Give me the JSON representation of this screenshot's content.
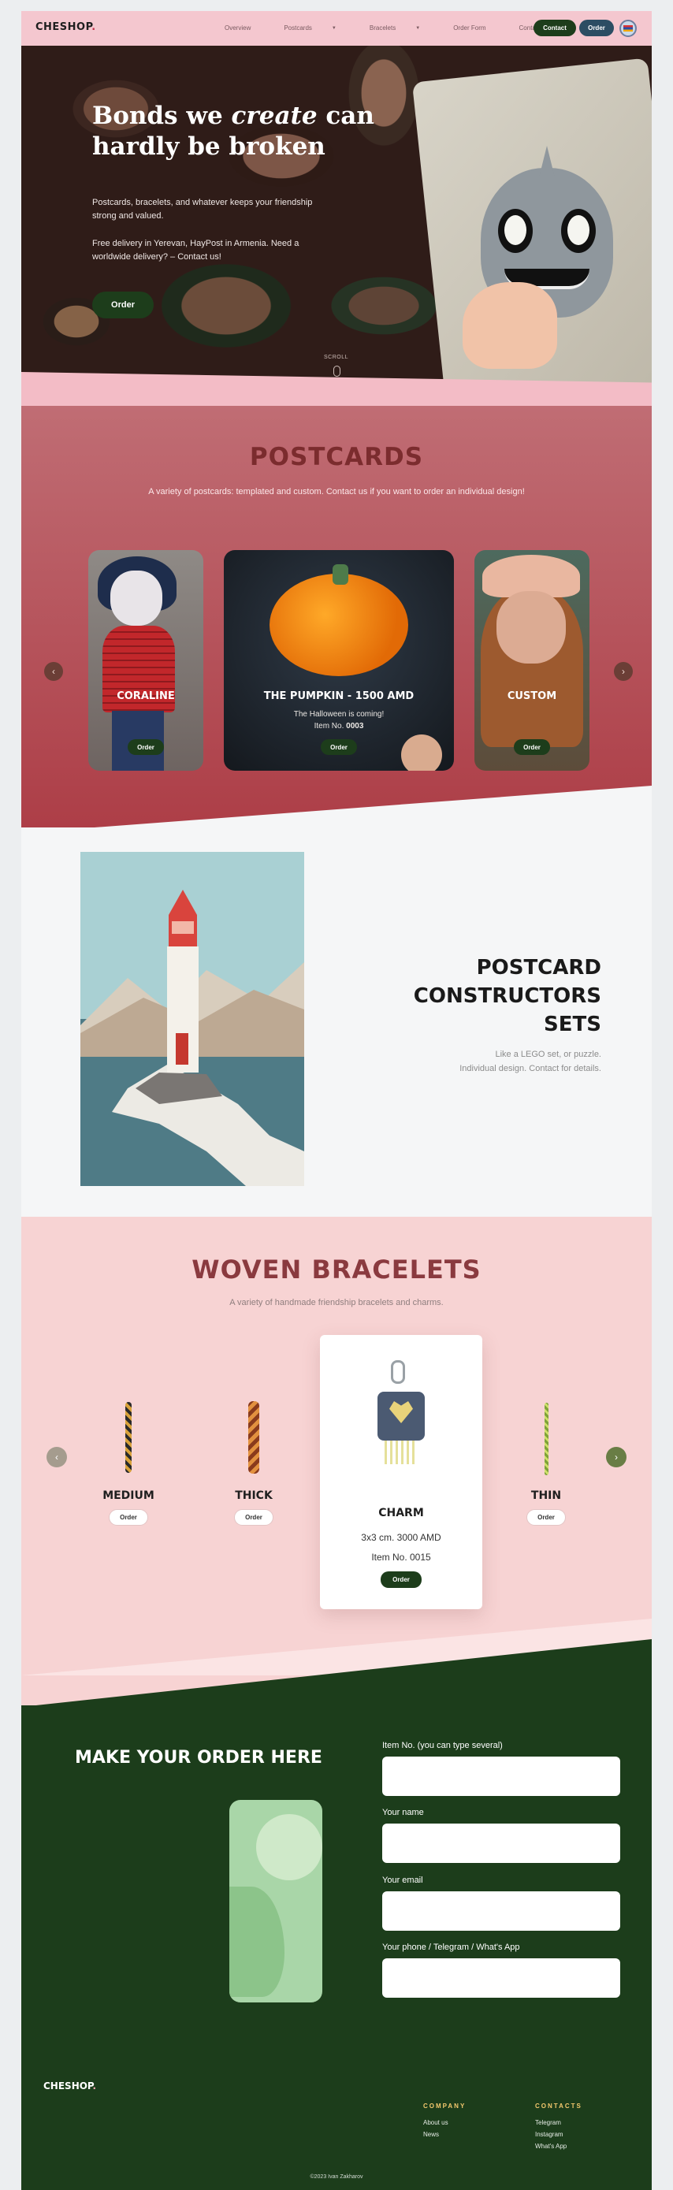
{
  "header": {
    "logo": "CHESHOP",
    "logo_dot": ".",
    "nav": [
      "Overview",
      "Postcards",
      "Bracelets",
      "Order Form",
      "Contacts"
    ],
    "contact_button": "Contact",
    "order_button": "Order",
    "language": "Armenian flag"
  },
  "hero": {
    "title_line1_a": "Bonds we ",
    "title_line1_em": "create",
    "title_line1_b": " can",
    "title_line2": "hardly be broken",
    "paragraph1": "Postcards, bracelets, and whatever keeps your friendship strong and valued.",
    "paragraph2": "Free delivery in Yerevan, HayPost in Armenia. Need a worldwide delivery? – Contact us!",
    "order_button": "Order",
    "scroll_label": "SCROLL"
  },
  "postcards": {
    "title": "POSTCARDS",
    "subtitle": "A variety of postcards: templated and custom. Contact us if you want to order an individual design!",
    "prev_arrow": "‹",
    "next_arrow": "›",
    "cards": [
      {
        "name": "CORALINE",
        "button": "Order"
      },
      {
        "name": "THE PUMPKIN - 1500 AMD",
        "description": "The Halloween is coming!",
        "item_label": "Item No. ",
        "item_no": "0003",
        "button": "Order"
      },
      {
        "name": "CUSTOM",
        "button": "Order"
      }
    ]
  },
  "constructors": {
    "title_line1": "POSTCARD",
    "title_line2": "CONSTRUCTORS",
    "title_line3": "SETS",
    "subtitle_line1": "Like a LEGO set, or puzzle.",
    "subtitle_line2": "Individual design. Contact for details."
  },
  "bracelets": {
    "title": "WOVEN BRACELETS",
    "subtitle": "A variety of handmade friendship bracelets and charms.",
    "prev_arrow": "‹",
    "next_arrow": "›",
    "items": [
      {
        "name": "MEDIUM",
        "button": "Order"
      },
      {
        "name": "THICK",
        "button": "Order"
      },
      {
        "name": "CHARM",
        "size_price": "3x3 cm. 3000 AMD",
        "item_no": "Item No. 0015",
        "button": "Order"
      },
      {
        "name": "THIN",
        "button": "Order"
      }
    ]
  },
  "order": {
    "title": "MAKE YOUR ORDER HERE",
    "fields": [
      {
        "label": "Item No. (you can type several)",
        "value": ""
      },
      {
        "label": "Your name",
        "value": ""
      },
      {
        "label": "Your email",
        "value": ""
      },
      {
        "label": "Your phone / Telegram / What's App",
        "value": ""
      }
    ]
  },
  "footer": {
    "logo": "CHESHOP",
    "logo_dot": ".",
    "company_heading": "COMPANY",
    "company_links": [
      "About us",
      "News"
    ],
    "contacts_heading": "CONTACTS",
    "contacts_links": [
      "Telegram",
      "Instagram",
      "What's App"
    ],
    "copyright": "©2023 Ivan Zakharov"
  },
  "colors": {
    "header_bg": "#f4c7cf",
    "primary_green": "#1d3d1b",
    "secondary_blue": "#2c4d63",
    "postcards_bg": "#b4505a",
    "postcards_title": "#7b2c2e",
    "bracelets_bg": "#f7d3d3",
    "bracelets_title": "#8a3a3f",
    "footer_accent": "#f3c86d"
  }
}
